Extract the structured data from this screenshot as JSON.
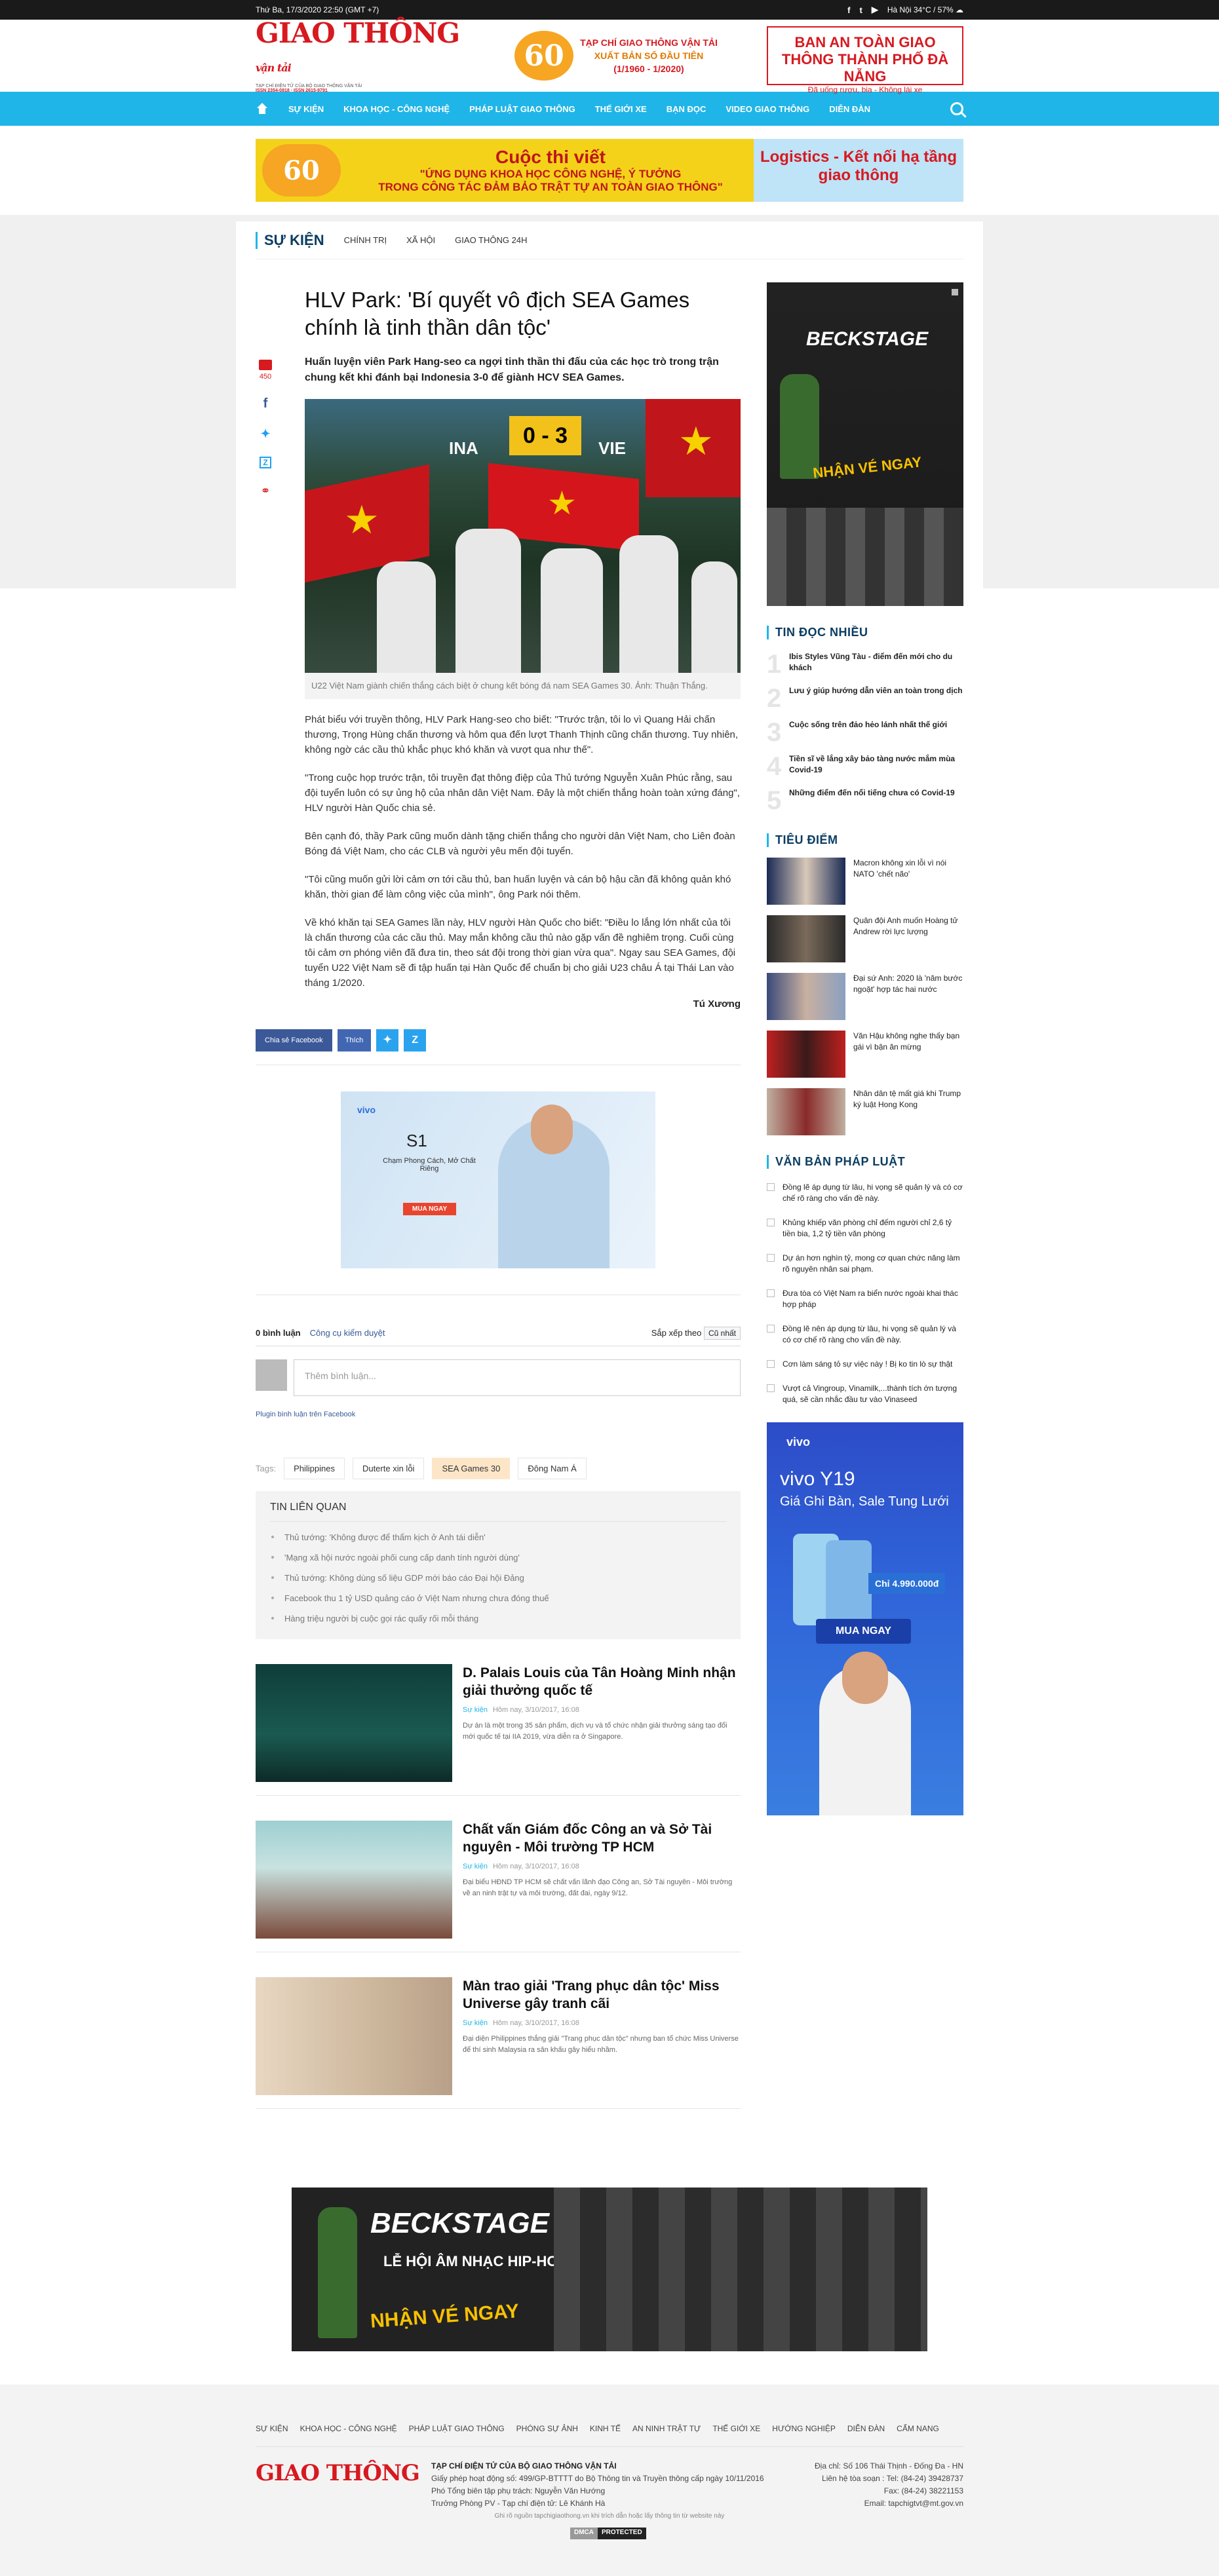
{
  "topbar": {
    "date": "Thứ Ba, 17/3/2020 22:50 (GMT +7)",
    "weather": "Hà Nội 34°C / 57% ☁"
  },
  "header": {
    "logo_text": "GIAO THÔNG",
    "logo_sub": "vận tải",
    "logo_line1": "TẠP CHÍ ĐIỆN TỬ CỦA BỘ GIAO THÔNG VẬN TẢI",
    "logo_line2": "ISSN 2354-0818 · ISSN 2615-9791",
    "ann_num": "60",
    "ann_title": "TẠP CHÍ GIAO THÔNG VẬN TẢI",
    "ann_sub": "XUẤT BẢN SỐ ĐẦU TIÊN",
    "ann_date": "(1/1960 - 1/2020)",
    "box_title": "BAN AN TOÀN GIAO THÔNG THÀNH PHỐ ĐÀ NẴNG",
    "box_sub": "Đã uống rượu, bia - Không lái xe"
  },
  "nav": [
    "SỰ KIỆN",
    "KHOA HỌC - CÔNG NGHỆ",
    "PHÁP LUẬT GIAO THÔNG",
    "THẾ GIỚI XE",
    "BẠN ĐỌC",
    "VIDEO GIAO THÔNG",
    "DIỄN ĐÀN"
  ],
  "banner": {
    "num": "60",
    "title": "Cuộc thi viết",
    "line1": "\"ỨNG DỤNG KHOA HỌC CÔNG NGHỆ, Ý TƯỞNG",
    "line2": "TRONG CÔNG TÁC ĐẢM BẢO TRẬT TỰ AN TOÀN GIAO THÔNG\"",
    "right": "Logistics - Kết nối hạ tầng giao thông"
  },
  "crumb": {
    "cat": "SỰ KIỆN",
    "subs": [
      "CHÍNH TRỊ",
      "XÃ HỘI",
      "GIAO THÔNG 24H"
    ]
  },
  "share": {
    "comments": "450"
  },
  "article": {
    "title": "HLV Park: 'Bí quyết vô địch SEA Games chính là tinh thần dân tộc'",
    "sapo": "Huấn luyện viên Park Hang-seo ca ngợi tinh thần thi đấu của các học trò trong trận chung kết khi đánh bại Indonesia 3-0 để giành HCV SEA Games.",
    "score": "0 - 3",
    "team1": "INA",
    "team2": "VIE",
    "caption": "U22 Việt Nam giành chiến thắng cách biệt ở chung kết bóng đá nam SEA Games 30. Ảnh: Thuận Thắng.",
    "paras": [
      "Phát biểu với truyền thông, HLV Park Hang-seo cho biết: \"Trước trận, tôi lo vì Quang Hải chấn thương, Trọng Hùng chấn thương và hôm qua đến lượt Thanh Thịnh cũng chấn thương. Tuy nhiên, không ngờ các cầu thủ khắc phục khó khăn và vượt qua như thế\".",
      "\"Trong cuộc họp trước trận, tôi truyền đạt thông điệp của Thủ tướng Nguyễn Xuân Phúc rằng, sau đội tuyển luôn có sự ủng hộ của nhân dân Việt Nam. Đây là một chiến thắng hoàn toàn xứng đáng\", HLV người Hàn Quốc chia sẻ.",
      "Bên cạnh đó, thầy Park cũng muốn dành tặng chiến thắng cho người dân Việt Nam, cho Liên đoàn Bóng đá Việt Nam, cho các CLB và người yêu mến đội tuyển.",
      "\"Tôi cũng muốn gửi lời cảm ơn tới cầu thủ, ban huấn luyện và cán bộ hậu cần đã không quản khó khăn, thời gian để làm công việc của mình\", ông Park nói thêm.",
      "Về khó khăn tại SEA Games lần này, HLV người Hàn Quốc cho biết: \"Điều lo lắng lớn nhất của tôi là chấn thương của các cầu thủ. May mắn không cầu thủ nào gặp vấn đề nghiêm trọng. Cuối cùng tôi cảm ơn phóng viên đã đưa tin, theo sát đội trong thời gian vừa qua\".  Ngay sau SEA Games, đội tuyển U22 Việt Nam sẽ đi tập huấn tại Hàn Quốc để chuẩn bị cho giải U23 châu Á tại Thái Lan vào tháng 1/2020."
    ],
    "author": "Tú Xương"
  },
  "sharebar": {
    "fb": "Chia sẻ Facebook",
    "like": "Thích"
  },
  "adv": {
    "brand": "vivo",
    "model": "S1",
    "slogan": "Chạm Phong Cách, Mở Chất Riêng",
    "buy": "MUA NGAY"
  },
  "comments": {
    "count": "0 bình luận",
    "tool": "Công cụ kiểm duyệt",
    "sort_label": "Sắp xếp theo",
    "sort_value": "Cũ nhất",
    "placeholder": "Thêm bình luận...",
    "plugin": "Plugin bình luận trên Facebook"
  },
  "tags": {
    "label": "Tags:",
    "items": [
      "Philippines",
      "Duterte xin lỗi",
      "SEA Games 30",
      "Đông Nam Á"
    ]
  },
  "related": {
    "title": "TIN LIÊN QUAN",
    "items": [
      "Thủ tướng: 'Không được để thẩm kịch ở Anh tái diễn'",
      "'Mạng xã hội nước ngoài phối cung cấp danh tính người dùng'",
      "Thủ tướng: Không dùng số liệu GDP mới báo cáo Đại hội Đảng",
      "Facebook thu 1 tỷ USD quảng cáo ở Việt Nam nhưng chưa đóng thuế",
      "Hàng triệu người bị cuộc gọi rác quấy rối mỗi tháng"
    ]
  },
  "news": [
    {
      "title": "D. Palais Louis của Tân Hoàng Minh nhận giải thưởng quốc tế",
      "cat": "Sự kiện",
      "time": "Hôm nay, 3/10/2017, 16:08",
      "sum": "Dự án là một trong 35 sản phẩm, dịch vụ và tổ chức nhận giải thưởng sáng tạo đổi mới quốc tế tại IIA 2019, vừa diễn ra ở Singapore."
    },
    {
      "title": "Chất vấn Giám đốc Công an và Sở Tài nguyên - Môi trường TP HCM",
      "cat": "Sự kiện",
      "time": "Hôm nay, 3/10/2017, 16:08",
      "sum": "Đại biểu HĐND TP HCM sẽ chất vấn lãnh đạo Công an, Sở Tài nguyên - Môi trường về an ninh trật tự và môi trường, đất đai, ngày 9/12."
    },
    {
      "title": "Màn trao giải 'Trang phục dân tộc' Miss Universe gây tranh cãi",
      "cat": "Sự kiện",
      "time": "Hôm nay, 3/10/2017, 16:08",
      "sum": "Đại diện Philippines thắng giải \"Trang phục dân tộc\" nhưng ban tổ chức Miss Universe để thí sinh Malaysia ra sân khấu gây hiểu nhầm."
    }
  ],
  "sidebar": {
    "ad_top": {
      "brand": "BECKSTAGE",
      "cta": "NHẬN VÉ NGAY"
    },
    "popular_title": "TIN ĐỌC NHIỀU",
    "popular": [
      "Ibis Styles Vũng Tàu - điểm đến mới cho du khách",
      "Lưu ý giúp hướng dẫn viên an toàn trong dịch",
      "Cuộc sống trên đảo hẻo lánh nhất thế giới",
      "Tiền sĩ về lắng xây bảo tàng nước mắm mùa Covid-19",
      "Những điểm đến nổi tiếng chưa có Covid-19"
    ],
    "focus_title": "TIÊU ĐIỂM",
    "focus": [
      "Macron không xin lỗi vì nói NATO 'chết não'",
      "Quân đội Anh muốn Hoàng tử Andrew rời lực lượng",
      "Đại sứ Anh: 2020 là 'năm bước ngoặt' hợp tác hai nước",
      "Văn Hậu không nghe thấy bạn gái vì bận ăn mừng",
      "Nhân dân tệ mất giá khi Trump ký luật Hong Kong"
    ],
    "law_title": "VĂN BẢN PHÁP LUẬT",
    "law": [
      "Đồng lẽ áp dụng từ lâu, hi vọng sẽ quản lý và có cơ chế rõ ràng cho vấn đề này.",
      "Khủng khiếp văn phòng chỉ đếm người chỉ 2,6 tỷ tiền bia, 1,2 tỷ tiền văn phòng",
      "Dự án hơn nghìn tỷ, mong cơ quan chức năng làm rõ nguyên nhân sai phạm.",
      "Đưa tòa có Việt Nam ra biển nước ngoài khai thác hợp pháp",
      "Đồng lẽ nên áp dụng từ lâu, hi vọng sẽ quản lý và có cơ chế rõ ràng cho vấn đề này.",
      "Cơn làm sáng tỏ sự việc này ! Bị ko tin lò sự thật",
      "Vượt cả Vingroup, Vinamilk,...thành tích ớn tượng quá, sẽ cần nhắc đầu tư vào Vinaseed"
    ],
    "ad_vivo": {
      "brand": "vivo",
      "model": "vivo Y19",
      "slogan": "Giá Ghi Bàn, Sale Tung Lưới",
      "price": "Chỉ 4.990.000đ",
      "buy": "MUA NGAY"
    }
  },
  "bigad": {
    "brand": "BECKSTAGE",
    "sub": "LỄ HỘI ÂM NHẠC HIP-HOP LỚN NHẤT VIỆT NAM",
    "cta": "NHẬN VÉ NGAY"
  },
  "footer": {
    "links": [
      "SỰ KIỆN",
      "KHOA HỌC - CÔNG NGHỆ",
      "PHÁP LUẬT GIAO THÔNG",
      "PHÓNG SỰ ẢNH",
      "KINH TẾ",
      "AN NINH TRẬT TỰ",
      "THẾ GIỚI XE",
      "HƯỚNG NGHIỆP",
      "DIỄN ĐÀN",
      "CẨM NANG"
    ],
    "logo": "GIAO THÔNG",
    "org": "TẠP CHÍ ĐIỆN TỬ CỦA BỘ GIAO THÔNG VẬN TẢI",
    "license": "Giấy phép hoạt động số: 499/GP-BTTTT do Bộ Thông tin và Truyền thông cấp ngày 10/11/2016",
    "deputy": "Phó Tổng biên tập phụ trách: Nguyễn Văn Hướng",
    "head": "Trưởng Phòng PV - Tạp chí điện tử: Lê Khánh Hà",
    "address": "Địa chỉ: Số 106 Thái Thịnh - Đống Đa - HN",
    "tel": "Liên hệ tòa soạn : Tel: (84-24) 39428737",
    "fax": "Fax: (84-24) 38221153",
    "email": "Email: tapchigtvt@mt.gov.vn",
    "note": "Ghi rõ nguồn tapchigiaothong.vn khi trích dẫn hoặc lấy thông tin từ website này",
    "dmca1": "DMCA",
    "dmca2": "PROTECTED"
  }
}
